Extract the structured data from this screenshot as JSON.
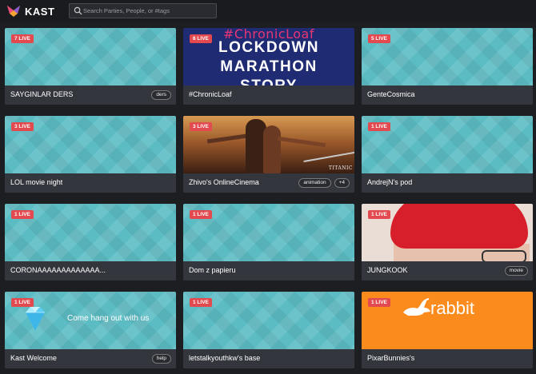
{
  "app": {
    "name": "KAST"
  },
  "search": {
    "placeholder": "Search Parties, People, or #tags"
  },
  "colors": {
    "live_badge": "#e24a4f",
    "card_footer": "#34363d",
    "background": "#1d1e22",
    "thumb_teal": "#5bbcc3"
  },
  "cards": [
    {
      "live": "7 LIVE",
      "title": "SAYGINLAR DERS",
      "tags": [
        "ders"
      ]
    },
    {
      "live": "6 LIVE",
      "title": "#ChronicLoaf",
      "tags": [],
      "thumb_text": [
        "#ChronicLoaf",
        "LOCKDOWN",
        "MARATHON",
        "STORY"
      ]
    },
    {
      "live": "5 LIVE",
      "title": "GenteCosmica",
      "tags": []
    },
    {
      "live": "3 LIVE",
      "title": "LOL movie night",
      "tags": []
    },
    {
      "live": "3 LIVE",
      "title": "Zhivo's OnlineCinema",
      "tags": [
        "animation",
        "+4"
      ],
      "thumb_text": "TITANIC"
    },
    {
      "live": "1 LIVE",
      "title": "AndrejN's pod",
      "tags": []
    },
    {
      "live": "1 LIVE",
      "title": "CORONAAAAAAAAAAAAA...",
      "tags": []
    },
    {
      "live": "1 LIVE",
      "title": "Dom z papieru",
      "tags": []
    },
    {
      "live": "1 LIVE",
      "title": "JUNGKOOK",
      "tags": [
        "movie"
      ]
    },
    {
      "live": "1 LIVE",
      "title": "Kast Welcome",
      "tags": [
        "help"
      ],
      "thumb_text": "Come hang out with us"
    },
    {
      "live": "1 LIVE",
      "title": "letstalkyouthkw's base",
      "tags": []
    },
    {
      "live": "1 LIVE",
      "title": "PixarBunnies's",
      "tags": [],
      "thumb_text": "rabbit"
    }
  ]
}
